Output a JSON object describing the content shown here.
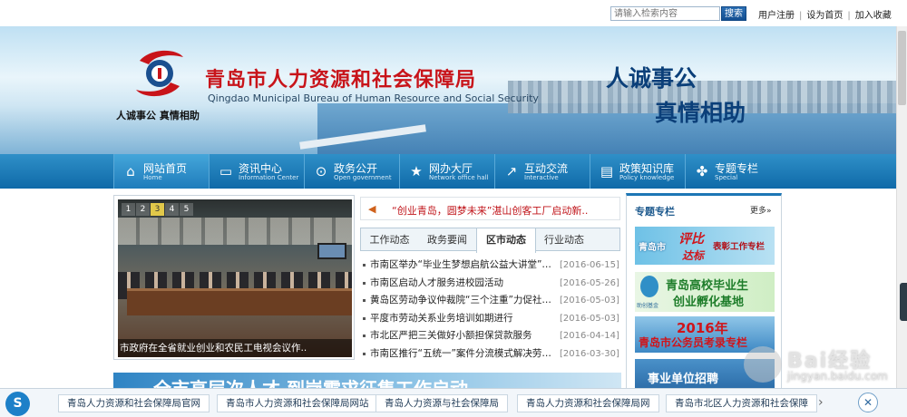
{
  "topbar": {
    "search_placeholder": "请输入检索内容",
    "search_button": "搜索",
    "links": [
      "用户注册",
      "设为首页",
      "加入收藏"
    ]
  },
  "banner": {
    "title": "青岛市人力资源和社会保障局",
    "subtitle": "Qingdao Municipal Bureau of Human Resource and Social Security",
    "slogan_small": "人诚事公  真情相助",
    "slogan_line1": "人诚事公",
    "slogan_line2": "真情相助"
  },
  "nav": {
    "items": [
      {
        "label": "网站首页",
        "sub": "Home",
        "icon": "home-icon"
      },
      {
        "label": "资讯中心",
        "sub": "Information Center",
        "icon": "folder-icon"
      },
      {
        "label": "政务公开",
        "sub": "Open government",
        "icon": "search-icon"
      },
      {
        "label": "网办大厅",
        "sub": "Network office hall",
        "icon": "star-icon"
      },
      {
        "label": "互动交流",
        "sub": "Interactive",
        "icon": "share-icon"
      },
      {
        "label": "政策知识库",
        "sub": "Policy knowledge",
        "icon": "book-icon"
      },
      {
        "label": "专题专栏",
        "sub": "Special",
        "icon": "puzzle-icon"
      }
    ]
  },
  "slider": {
    "pages": [
      "1",
      "2",
      "3",
      "4",
      "5"
    ],
    "active_page": "3",
    "caption": "市政府在全省就业创业和农民工电视会议作.."
  },
  "news": {
    "marquee": "“创业青岛，圆梦未来”湛山创客工厂启动新..",
    "tabs": [
      "工作动态",
      "政务要闻",
      "区市动态",
      "行业动态"
    ],
    "active_tab": "区市动态",
    "items": [
      {
        "title": "市南区举办“毕业生梦想启航公益大讲堂”…",
        "date": "[2016-06-15]"
      },
      {
        "title": "市南区启动人才服务进校园活动",
        "date": "[2016-05-26]"
      },
      {
        "title": "黄岛区劳动争议仲裁院“三个注重”力促社…",
        "date": "[2016-05-03]"
      },
      {
        "title": "平度市劳动关系业务培训如期进行",
        "date": "[2016-05-03]"
      },
      {
        "title": "市北区严把三关做好小额担保贷款服务",
        "date": "[2016-04-14]"
      },
      {
        "title": "市南区推行“五统一”案件分流模式解决劳…",
        "date": "[2016-03-30]"
      }
    ]
  },
  "special": {
    "title": "专题专栏",
    "more": "更多»",
    "promo1": {
      "a": "青岛市",
      "b": "评比",
      "c": "表彰工作专栏",
      "d": "达标"
    },
    "promo2": {
      "logo_text": "助创基金",
      "line1": "青岛高校毕业生",
      "line2": "创业孵化基地"
    },
    "promo3": {
      "year": "2016年",
      "line": "青岛市公务员考录专栏"
    },
    "promo4": {
      "line": "事业单位招聘"
    }
  },
  "wide_banner": "全市高层次人才  到岗需求征集工作启动",
  "watermark": {
    "brand": "Bai经验",
    "url": "jingyan.baidu.com"
  },
  "suggest": {
    "logo": "S",
    "chips": [
      "青岛人力资源和社会保障局官网",
      "青岛市人力资源和社会保障局网站",
      "青岛人力资源与社会保障局",
      "青岛人力资源和社会保障局网",
      "青岛市北区人力资源和社会保障"
    ],
    "next": "›",
    "close": "✕"
  }
}
